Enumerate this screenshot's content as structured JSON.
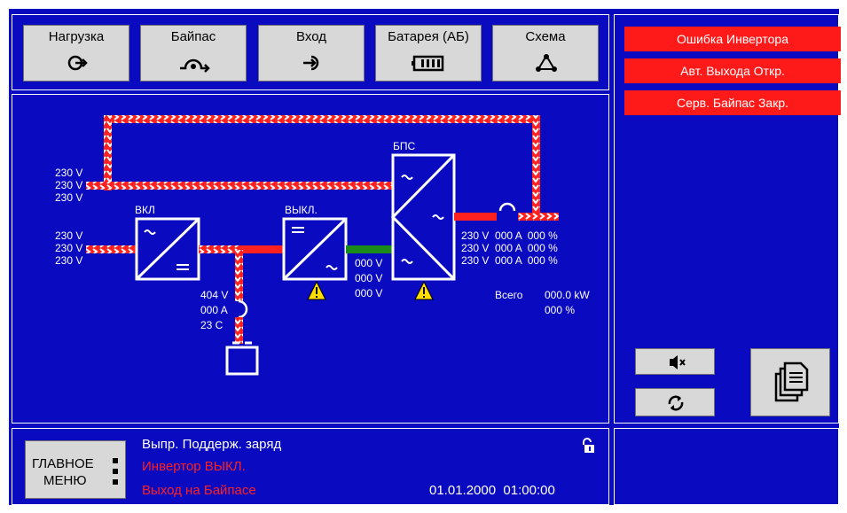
{
  "tabs": [
    {
      "label": "Нагрузка",
      "icon": "load-output-icon"
    },
    {
      "label": "Байпас",
      "icon": "bypass-icon"
    },
    {
      "label": "Вход",
      "icon": "input-icon"
    },
    {
      "label": "Батарея (АБ)",
      "icon": "battery-icon"
    },
    {
      "label": "Схема",
      "icon": "schema-icon"
    }
  ],
  "alarms": [
    "Ошибка Инвертора",
    "Авт. Выхода Откр.",
    "Серв. Байпас Закр."
  ],
  "diagram": {
    "bypass_voltages": [
      "230 V",
      "230 V",
      "230 V"
    ],
    "input_voltages": [
      "230 V",
      "230 V",
      "230 V"
    ],
    "rectifier_label": "ВКЛ",
    "inverter_label": "ВЫКЛ.",
    "static_switch_label": "БПС",
    "battery_readings": [
      "404 V",
      "000 A",
      "23 C"
    ],
    "inverter_voltages": [
      "000 V",
      "000 V",
      "000 V"
    ],
    "output_rows": [
      "230 V  000 A  000 %",
      "230 V  000 A  000 %",
      "230 V  000 A  000 %"
    ],
    "total_label": "Всего",
    "total_power": "000.0 kW",
    "total_percent": "000 %"
  },
  "main_menu_label_1": "ГЛАВНОЕ",
  "main_menu_label_2": "МЕНЮ",
  "status_lines": [
    {
      "text": "Выпр. Поддерж. заряд",
      "color": "#ffffff"
    },
    {
      "text": "Инвертор ВЫКЛ.",
      "color": "#ff2020"
    },
    {
      "text": "Выход на Байпасе",
      "color": "#ff2020"
    }
  ],
  "datetime": "01.01.2000  01:00:00",
  "colors": {
    "background": "#0a0ac0",
    "alarm": "#ff1a1a",
    "line_red": "#ff2020",
    "line_green": "#1a8a1a",
    "warning": "#ffdd00"
  }
}
